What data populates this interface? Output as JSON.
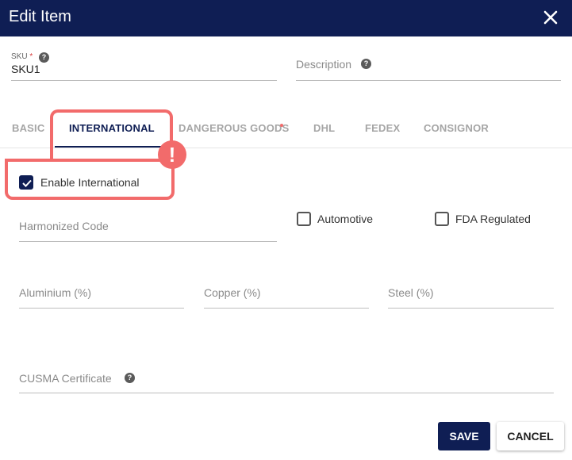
{
  "dialog": {
    "title": "Edit Item",
    "close_icon": "close-icon"
  },
  "sku": {
    "label": "SKU",
    "required_mark": "*",
    "value": "SKU1"
  },
  "description": {
    "placeholder": "Description"
  },
  "tabs": [
    {
      "label": "BASIC"
    },
    {
      "label": "INTERNATIONAL"
    },
    {
      "label": "DANGEROUS GOODS"
    },
    {
      "label": "DHL"
    },
    {
      "label": "FEDEX"
    },
    {
      "label": "CONSIGNOR"
    }
  ],
  "active_tab": "INTERNATIONAL",
  "alert_badge": "!",
  "enable_international": {
    "label": "Enable International",
    "checked": true
  },
  "harmonized_code": {
    "placeholder": "Harmonized Code"
  },
  "automotive": {
    "label": "Automotive",
    "checked": false
  },
  "fda_regulated": {
    "label": "FDA Regulated",
    "checked": false
  },
  "aluminium": {
    "placeholder": "Aluminium (%)"
  },
  "copper": {
    "placeholder": "Copper (%)"
  },
  "steel": {
    "placeholder": "Steel (%)"
  },
  "cusma": {
    "placeholder": "CUSMA Certificate"
  },
  "help_glyph": "?",
  "buttons": {
    "save": "SAVE",
    "cancel": "CANCEL"
  },
  "colors": {
    "primary": "#0f1e54",
    "highlight": "#f26b6b"
  }
}
